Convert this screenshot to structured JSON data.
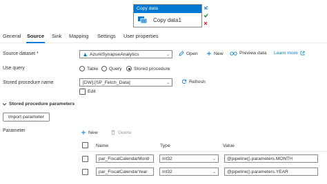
{
  "node": {
    "header": "Copy data",
    "name": "Copy data1"
  },
  "tabs": [
    "General",
    "Source",
    "Sink",
    "Mapping",
    "Settings",
    "User properties"
  ],
  "source": {
    "dataset_label": "Source dataset",
    "required_mark": "*",
    "dataset_value": "AzureSynapseAnalytics",
    "open_label": "Open",
    "new_label": "New",
    "preview_label": "Preview data",
    "learn_more": "Learn more",
    "use_query_label": "Use query",
    "query_options": [
      "Table",
      "Query",
      "Stored procedure"
    ],
    "selected_query": "Stored procedure",
    "sp_name_label": "Stored procedure name",
    "sp_name_value": "[DW].[SP_Fetch_Data]",
    "refresh_label": "Refresh",
    "edit_label": "Edit",
    "sp_params_label": "Stored procedure parameters",
    "import_label": "Import parameter",
    "parameter_label": "Parameter",
    "param_new": "New",
    "param_delete": "Delete"
  },
  "params_table": {
    "headers": [
      "Name",
      "Type",
      "Value"
    ],
    "rows": [
      {
        "name": "par_FiscalCalendarMontl",
        "type": "Int32",
        "value": "@pipeline().parameters.MONTH"
      },
      {
        "name": "par_FiscalCalendarYear",
        "type": "Int32",
        "value": "@pipeline().parameters.YEAR"
      }
    ]
  },
  "colors": {
    "accent": "#0078d4",
    "border": "#8a8886",
    "text": "#323130"
  },
  "icons": [
    "copy-data-icon",
    "activity-status-icon",
    "synapse-dataset-icon",
    "pencil-icon",
    "plus-icon",
    "glasses-icon",
    "external-link-icon",
    "refresh-icon",
    "chevron-down-icon",
    "trash-icon"
  ]
}
